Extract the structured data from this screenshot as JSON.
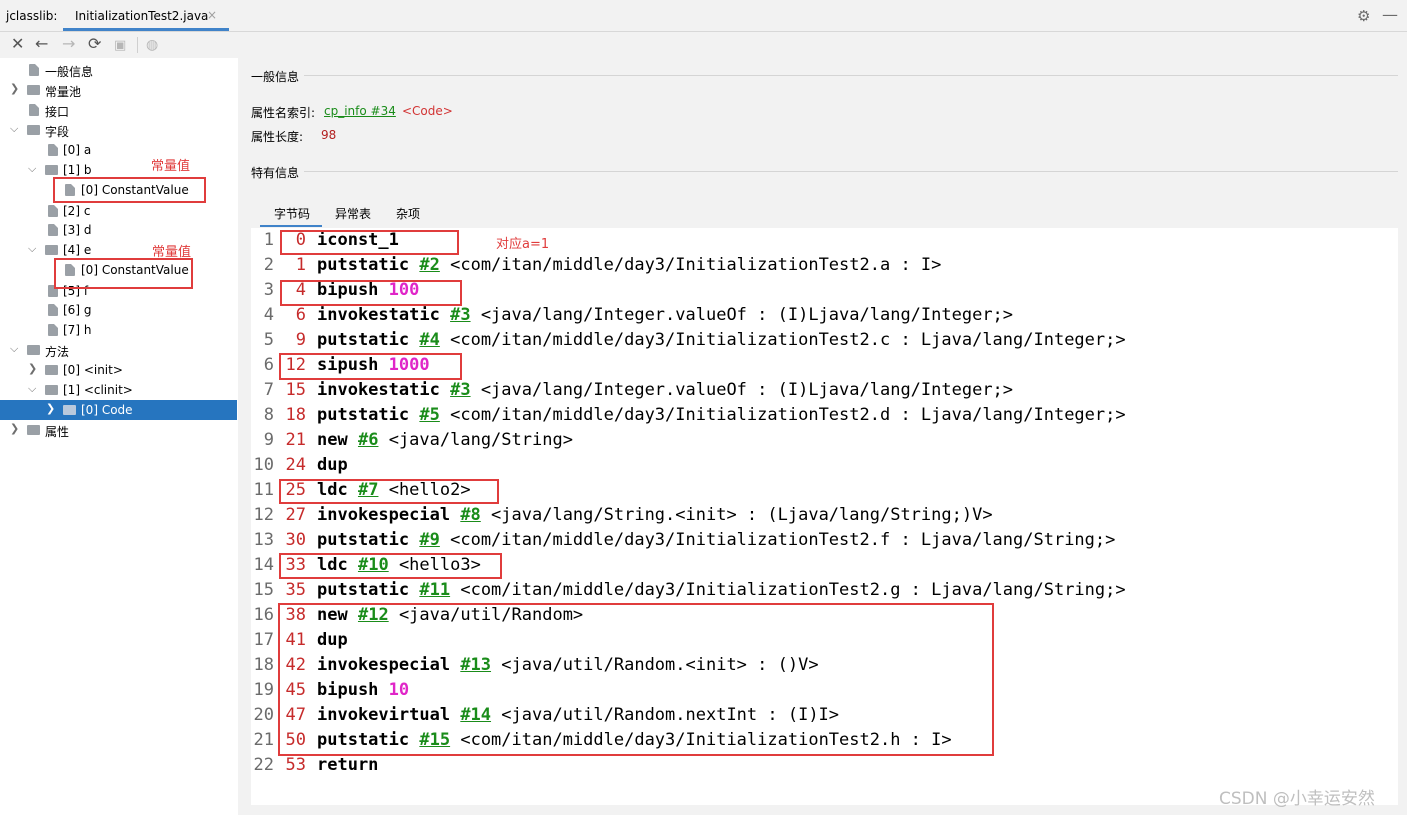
{
  "tabbar": {
    "tool_label": "jclasslib:",
    "active_tab": "InitializationTest2.java",
    "close_glyph": "×",
    "settings_icon": "gear-icon",
    "minimize_icon": "minus-icon"
  },
  "toolbar": {
    "buttons": [
      "close-icon",
      "back-arrow-icon",
      "forward-arrow-icon",
      "reload-icon",
      "save-icon",
      "web-icon"
    ]
  },
  "tree": {
    "items": [
      {
        "label": "一般信息"
      },
      {
        "label": "常量池"
      },
      {
        "label": "接口"
      },
      {
        "label": "字段"
      },
      {
        "label": "[0] a"
      },
      {
        "label": "[1] b"
      },
      {
        "label": "[0] ConstantValue"
      },
      {
        "label": "[2] c"
      },
      {
        "label": "[3] d"
      },
      {
        "label": "[4] e"
      },
      {
        "label": "[0] ConstantValue"
      },
      {
        "label": "[5] f"
      },
      {
        "label": "[6] g"
      },
      {
        "label": "[7] h"
      },
      {
        "label": "方法"
      },
      {
        "label": "[0] <init>"
      },
      {
        "label": "[1] <clinit>"
      },
      {
        "label": "[0] Code"
      },
      {
        "label": "属性"
      }
    ],
    "note_b": "常量值",
    "note_e": "常量值"
  },
  "info": {
    "general_title": "一般信息",
    "attr_name_label": "属性名索引:",
    "attr_name_link": "cp_info #34",
    "attr_name_value": "<Code>",
    "attr_len_label": "属性长度:",
    "attr_len_value": "98",
    "specific_title": "特有信息"
  },
  "subtabs": [
    "字节码",
    "异常表",
    "杂项"
  ],
  "code": {
    "note": "对应a=1",
    "rows": [
      {
        "ln": "1",
        "off": "0",
        "op": "iconst_1",
        "ref": "",
        "num": "",
        "cmt": ""
      },
      {
        "ln": "2",
        "off": "1",
        "op": "putstatic",
        "ref": "#2",
        "num": "",
        "cmt": "<com/itan/middle/day3/InitializationTest2.a : I>"
      },
      {
        "ln": "3",
        "off": "4",
        "op": "bipush",
        "ref": "",
        "num": "100",
        "cmt": ""
      },
      {
        "ln": "4",
        "off": "6",
        "op": "invokestatic",
        "ref": "#3",
        "num": "",
        "cmt": "<java/lang/Integer.valueOf : (I)Ljava/lang/Integer;>"
      },
      {
        "ln": "5",
        "off": "9",
        "op": "putstatic",
        "ref": "#4",
        "num": "",
        "cmt": "<com/itan/middle/day3/InitializationTest2.c : Ljava/lang/Integer;>"
      },
      {
        "ln": "6",
        "off": "12",
        "op": "sipush",
        "ref": "",
        "num": "1000",
        "cmt": ""
      },
      {
        "ln": "7",
        "off": "15",
        "op": "invokestatic",
        "ref": "#3",
        "num": "",
        "cmt": "<java/lang/Integer.valueOf : (I)Ljava/lang/Integer;>"
      },
      {
        "ln": "8",
        "off": "18",
        "op": "putstatic",
        "ref": "#5",
        "num": "",
        "cmt": "<com/itan/middle/day3/InitializationTest2.d : Ljava/lang/Integer;>"
      },
      {
        "ln": "9",
        "off": "21",
        "op": "new",
        "ref": "#6",
        "num": "",
        "cmt": "<java/lang/String>"
      },
      {
        "ln": "10",
        "off": "24",
        "op": "dup",
        "ref": "",
        "num": "",
        "cmt": ""
      },
      {
        "ln": "11",
        "off": "25",
        "op": "ldc",
        "ref": "#7",
        "num": "",
        "cmt": "<hello2>"
      },
      {
        "ln": "12",
        "off": "27",
        "op": "invokespecial",
        "ref": "#8",
        "num": "",
        "cmt": "<java/lang/String.<init> : (Ljava/lang/String;)V>"
      },
      {
        "ln": "13",
        "off": "30",
        "op": "putstatic",
        "ref": "#9",
        "num": "",
        "cmt": "<com/itan/middle/day3/InitializationTest2.f : Ljava/lang/String;>"
      },
      {
        "ln": "14",
        "off": "33",
        "op": "ldc",
        "ref": "#10",
        "num": "",
        "cmt": "<hello3>"
      },
      {
        "ln": "15",
        "off": "35",
        "op": "putstatic",
        "ref": "#11",
        "num": "",
        "cmt": "<com/itan/middle/day3/InitializationTest2.g : Ljava/lang/String;>"
      },
      {
        "ln": "16",
        "off": "38",
        "op": "new",
        "ref": "#12",
        "num": "",
        "cmt": "<java/util/Random>"
      },
      {
        "ln": "17",
        "off": "41",
        "op": "dup",
        "ref": "",
        "num": "",
        "cmt": ""
      },
      {
        "ln": "18",
        "off": "42",
        "op": "invokespecial",
        "ref": "#13",
        "num": "",
        "cmt": "<java/util/Random.<init> : ()V>"
      },
      {
        "ln": "19",
        "off": "45",
        "op": "bipush",
        "ref": "",
        "num": "10",
        "cmt": ""
      },
      {
        "ln": "20",
        "off": "47",
        "op": "invokevirtual",
        "ref": "#14",
        "num": "",
        "cmt": "<java/util/Random.nextInt : (I)I>"
      },
      {
        "ln": "21",
        "off": "50",
        "op": "putstatic",
        "ref": "#15",
        "num": "",
        "cmt": "<com/itan/middle/day3/InitializationTest2.h : I>"
      },
      {
        "ln": "22",
        "off": "53",
        "op": "return",
        "ref": "",
        "num": "",
        "cmt": ""
      }
    ]
  },
  "watermark": "CSDN @小幸运安然",
  "colors": {
    "accent": "#4083c9",
    "selection": "#2675bf",
    "annotation_red": "#e03c3c",
    "offset_red": "#c62b2b",
    "ref_green": "#1a8c1a",
    "number_magenta": "#e026c8"
  }
}
